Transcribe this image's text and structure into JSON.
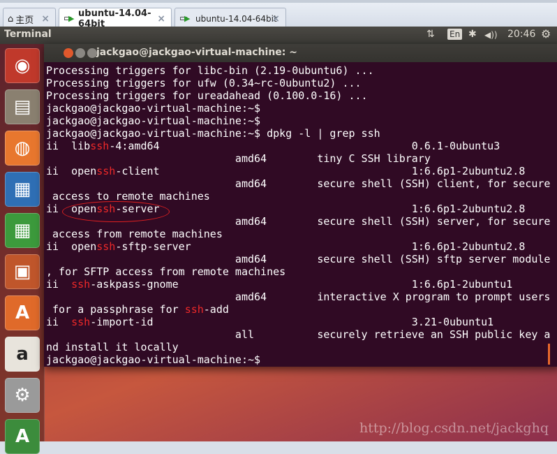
{
  "tabs": [
    {
      "label": "主页",
      "icon": "home-icon"
    },
    {
      "label": "ubuntu-14.04-64bit",
      "icon": "vm-icon",
      "active": true
    },
    {
      "label": "ubuntu-14.04-64bit",
      "icon": "vm-icon"
    }
  ],
  "tab_close": "×",
  "panel": {
    "title": "Terminal",
    "network": "⇅",
    "lang": "En",
    "bluetooth": "✱",
    "volume": "◀))",
    "time": "20:46",
    "gear": "⚙"
  },
  "terminal": {
    "title": "jackgao@jackgao-virtual-machine: ~",
    "lines": [
      {
        "t": "Processing triggers for libc-bin (2.19-0ubuntu6) ..."
      },
      {
        "t": "Processing triggers for ufw (0.34~rc-0ubuntu2) ..."
      },
      {
        "t": "Processing triggers for ureadahead (0.100.0-16) ..."
      },
      {
        "t": "jackgao@jackgao-virtual-machine:~$"
      },
      {
        "t": "jackgao@jackgao-virtual-machine:~$"
      },
      {
        "t": "jackgao@jackgao-virtual-machine:~$ dpkg -l | grep ssh"
      },
      {
        "t": "ii  libssh-4:amd64                                        0.6.1-0ubuntu3",
        "hl": true
      },
      {
        "t": "                              amd64        tiny C SSH library"
      },
      {
        "t": "ii  openssh-client                                        1:6.6p1-2ubuntu2.8",
        "hl": true
      },
      {
        "t": "                              amd64        secure shell (SSH) client, for secure"
      },
      {
        "t": " access to remote machines"
      },
      {
        "t": "ii  openssh-server                                        1:6.6p1-2ubuntu2.8",
        "hl": true
      },
      {
        "t": "                              amd64        secure shell (SSH) server, for secure"
      },
      {
        "t": " access from remote machines"
      },
      {
        "t": "ii  openssh-sftp-server                                   1:6.6p1-2ubuntu2.8",
        "hl": true
      },
      {
        "t": "                              amd64        secure shell (SSH) sftp server module"
      },
      {
        "t": ", for SFTP access from remote machines"
      },
      {
        "t": "ii  ssh-askpass-gnome                                     1:6.6p1-2ubuntu1",
        "hl": true
      },
      {
        "t": "                              amd64        interactive X program to prompt users"
      },
      {
        "t": " for a passphrase for ssh-add",
        "hl": true
      },
      {
        "t": "ii  ssh-import-id                                         3.21-0ubuntu1",
        "hl": true
      },
      {
        "t": "                              all          securely retrieve an SSH public key a"
      },
      {
        "t": "nd install it locally"
      },
      {
        "t": "jackgao@jackgao-virtual-machine:~$"
      }
    ]
  },
  "launcher": [
    {
      "name": "dash",
      "g": "◉",
      "c": "#c0392b"
    },
    {
      "name": "files",
      "g": "▤",
      "c": "#8a8070"
    },
    {
      "name": "firefox",
      "g": "◍",
      "c": "#e8772e"
    },
    {
      "name": "writer",
      "g": "▦",
      "c": "#2f6fb5"
    },
    {
      "name": "calc",
      "g": "▦",
      "c": "#3c9a3c"
    },
    {
      "name": "impress",
      "g": "▣",
      "c": "#c0562b"
    },
    {
      "name": "software-center",
      "g": "A",
      "c": "#e06a2a"
    },
    {
      "name": "amazon",
      "g": "a",
      "c": "#e8e4dc"
    },
    {
      "name": "settings",
      "g": "⚙",
      "c": "#9a9a9a"
    },
    {
      "name": "software-updater",
      "g": "A",
      "c": "#3c8c3c"
    }
  ],
  "watermark": "http://blog.csdn.net/jackghq"
}
